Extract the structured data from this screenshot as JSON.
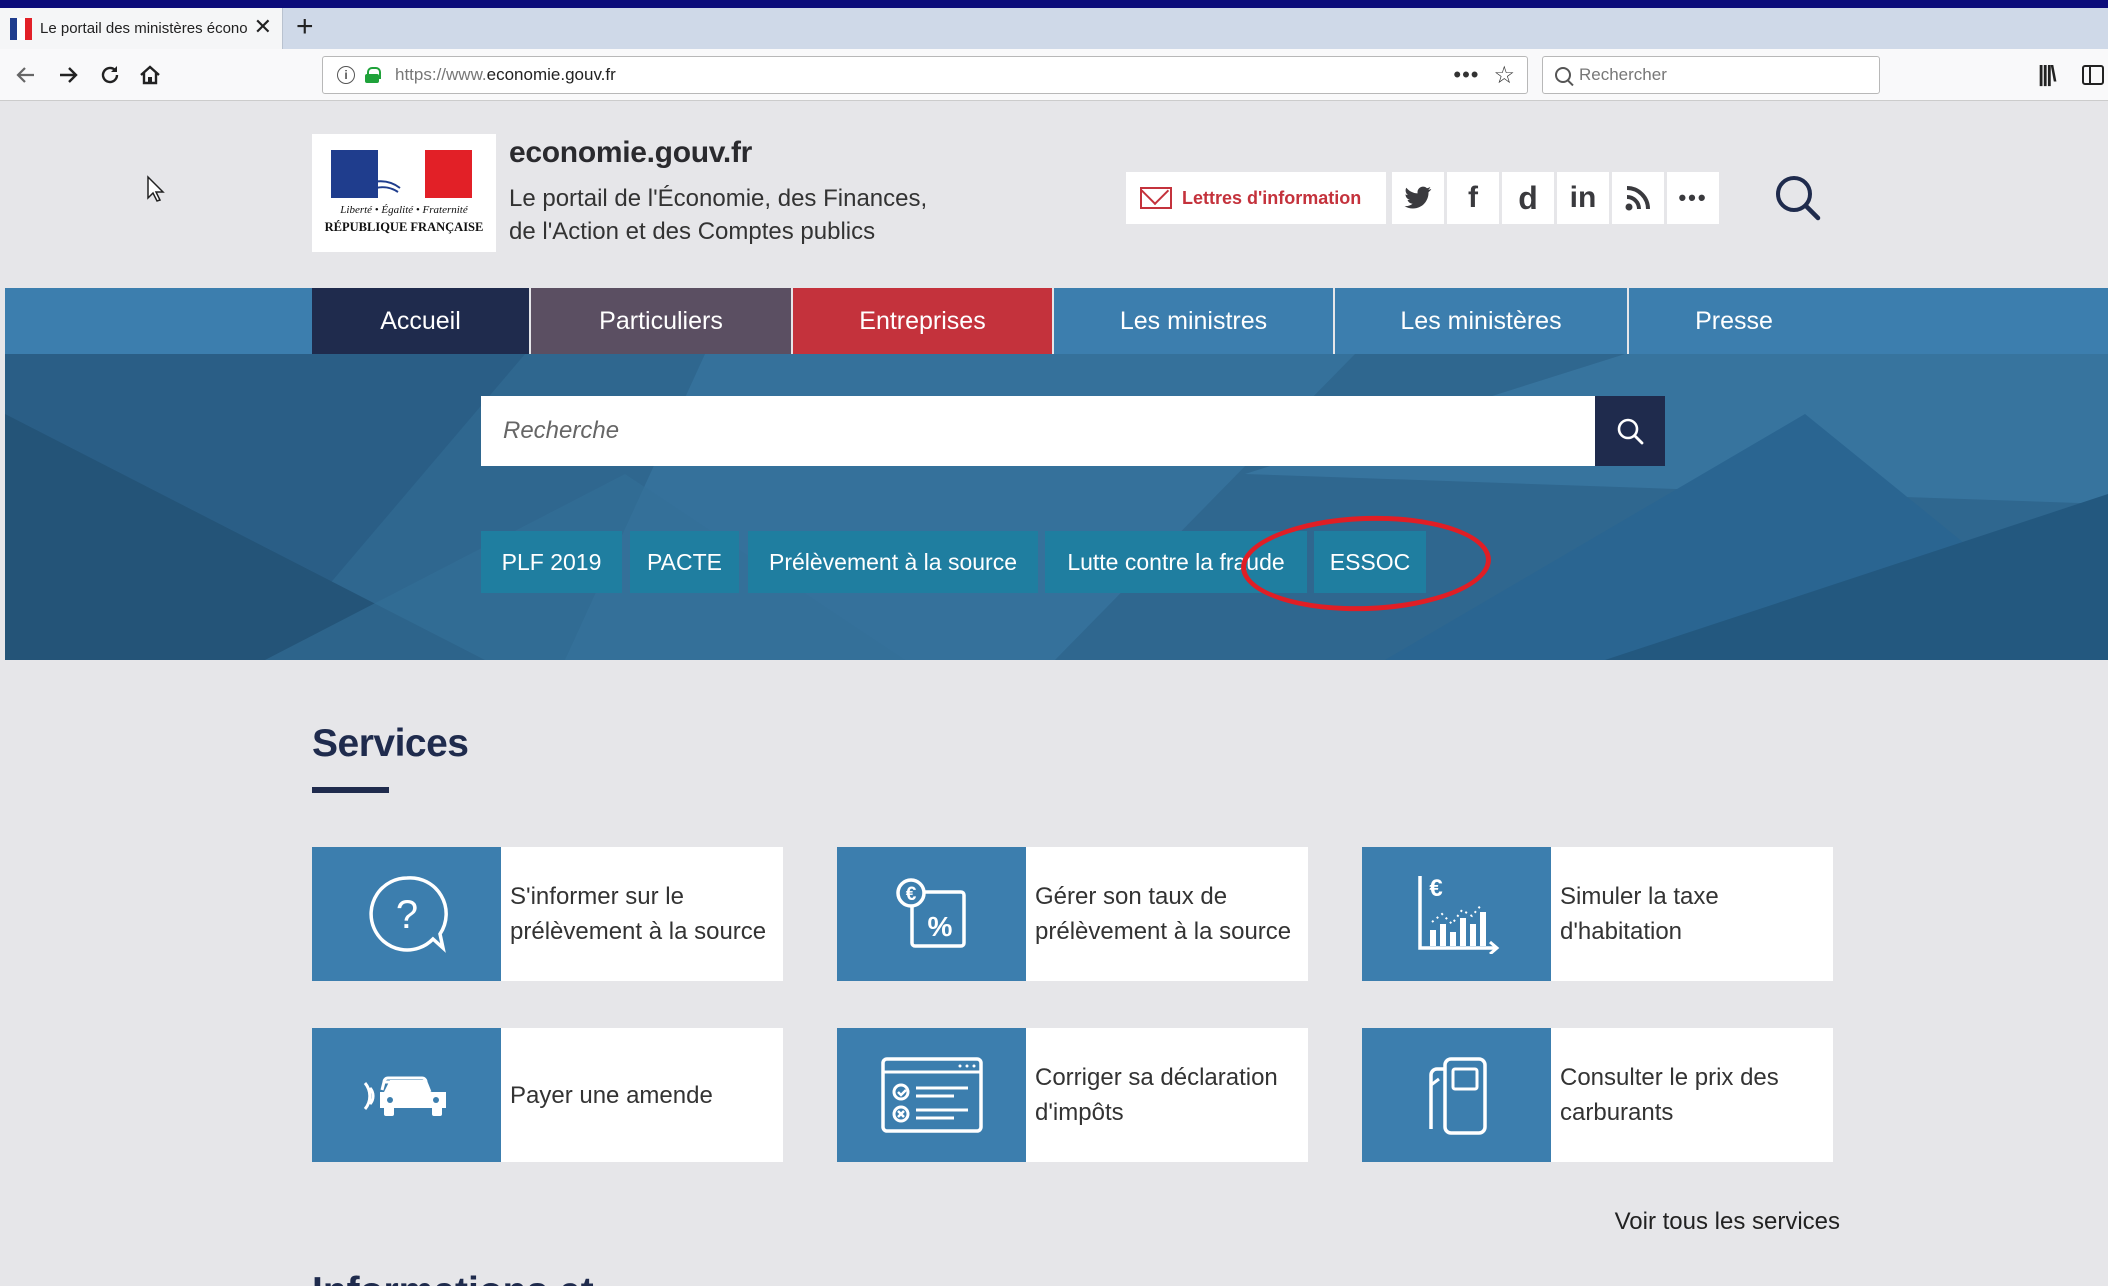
{
  "browser": {
    "tab_title": "Le portail des ministères écono",
    "url_prefix": "https://www.",
    "url_domain": "economie.gouv.fr",
    "search_placeholder": "Rechercher",
    "more_label": "•••"
  },
  "header": {
    "logo_motto": "Liberté • Égalité • Fraternité",
    "logo_name": "RÉPUBLIQUE FRANÇAISE",
    "site_name": "economie.gouv.fr",
    "tagline_1": "Le portail de l'Économie, des Finances,",
    "tagline_2": "de l'Action et des Comptes publics",
    "newsletter_label": "Lettres d'information",
    "social": [
      "t",
      "f",
      "d",
      "in",
      "rss",
      "•••"
    ]
  },
  "nav": {
    "items": [
      "Accueil",
      "Particuliers",
      "Entreprises",
      "Les ministres",
      "Les ministères",
      "Presse"
    ],
    "colors": {
      "accueil": "#1f2b4d",
      "particuliers": "#5b4f62",
      "entreprises": "#c4323c",
      "default": "#3c7eae"
    }
  },
  "hero": {
    "search_placeholder": "Recherche",
    "tags": [
      "PLF 2019",
      "PACTE",
      "Prélèvement à la source",
      "Lutte contre la fraude",
      "ESSOC"
    ]
  },
  "services": {
    "title": "Services",
    "cards": [
      {
        "label": "S'informer sur le prélèvement à la source",
        "icon": "question-bubble-icon"
      },
      {
        "label": "Gérer son taux de prélèvement à la source",
        "icon": "euro-percent-icon"
      },
      {
        "label": "Simuler la taxe d'habitation",
        "icon": "euro-chart-icon"
      },
      {
        "label": "Payer une amende",
        "icon": "car-radar-icon"
      },
      {
        "label": "Corriger sa déclaration d'impôts",
        "icon": "form-checklist-icon"
      },
      {
        "label": "Consulter le prix des carburants",
        "icon": "fuel-pump-icon"
      }
    ],
    "all_link": "Voir tous les services"
  },
  "next_section": {
    "title": "Informations et"
  }
}
